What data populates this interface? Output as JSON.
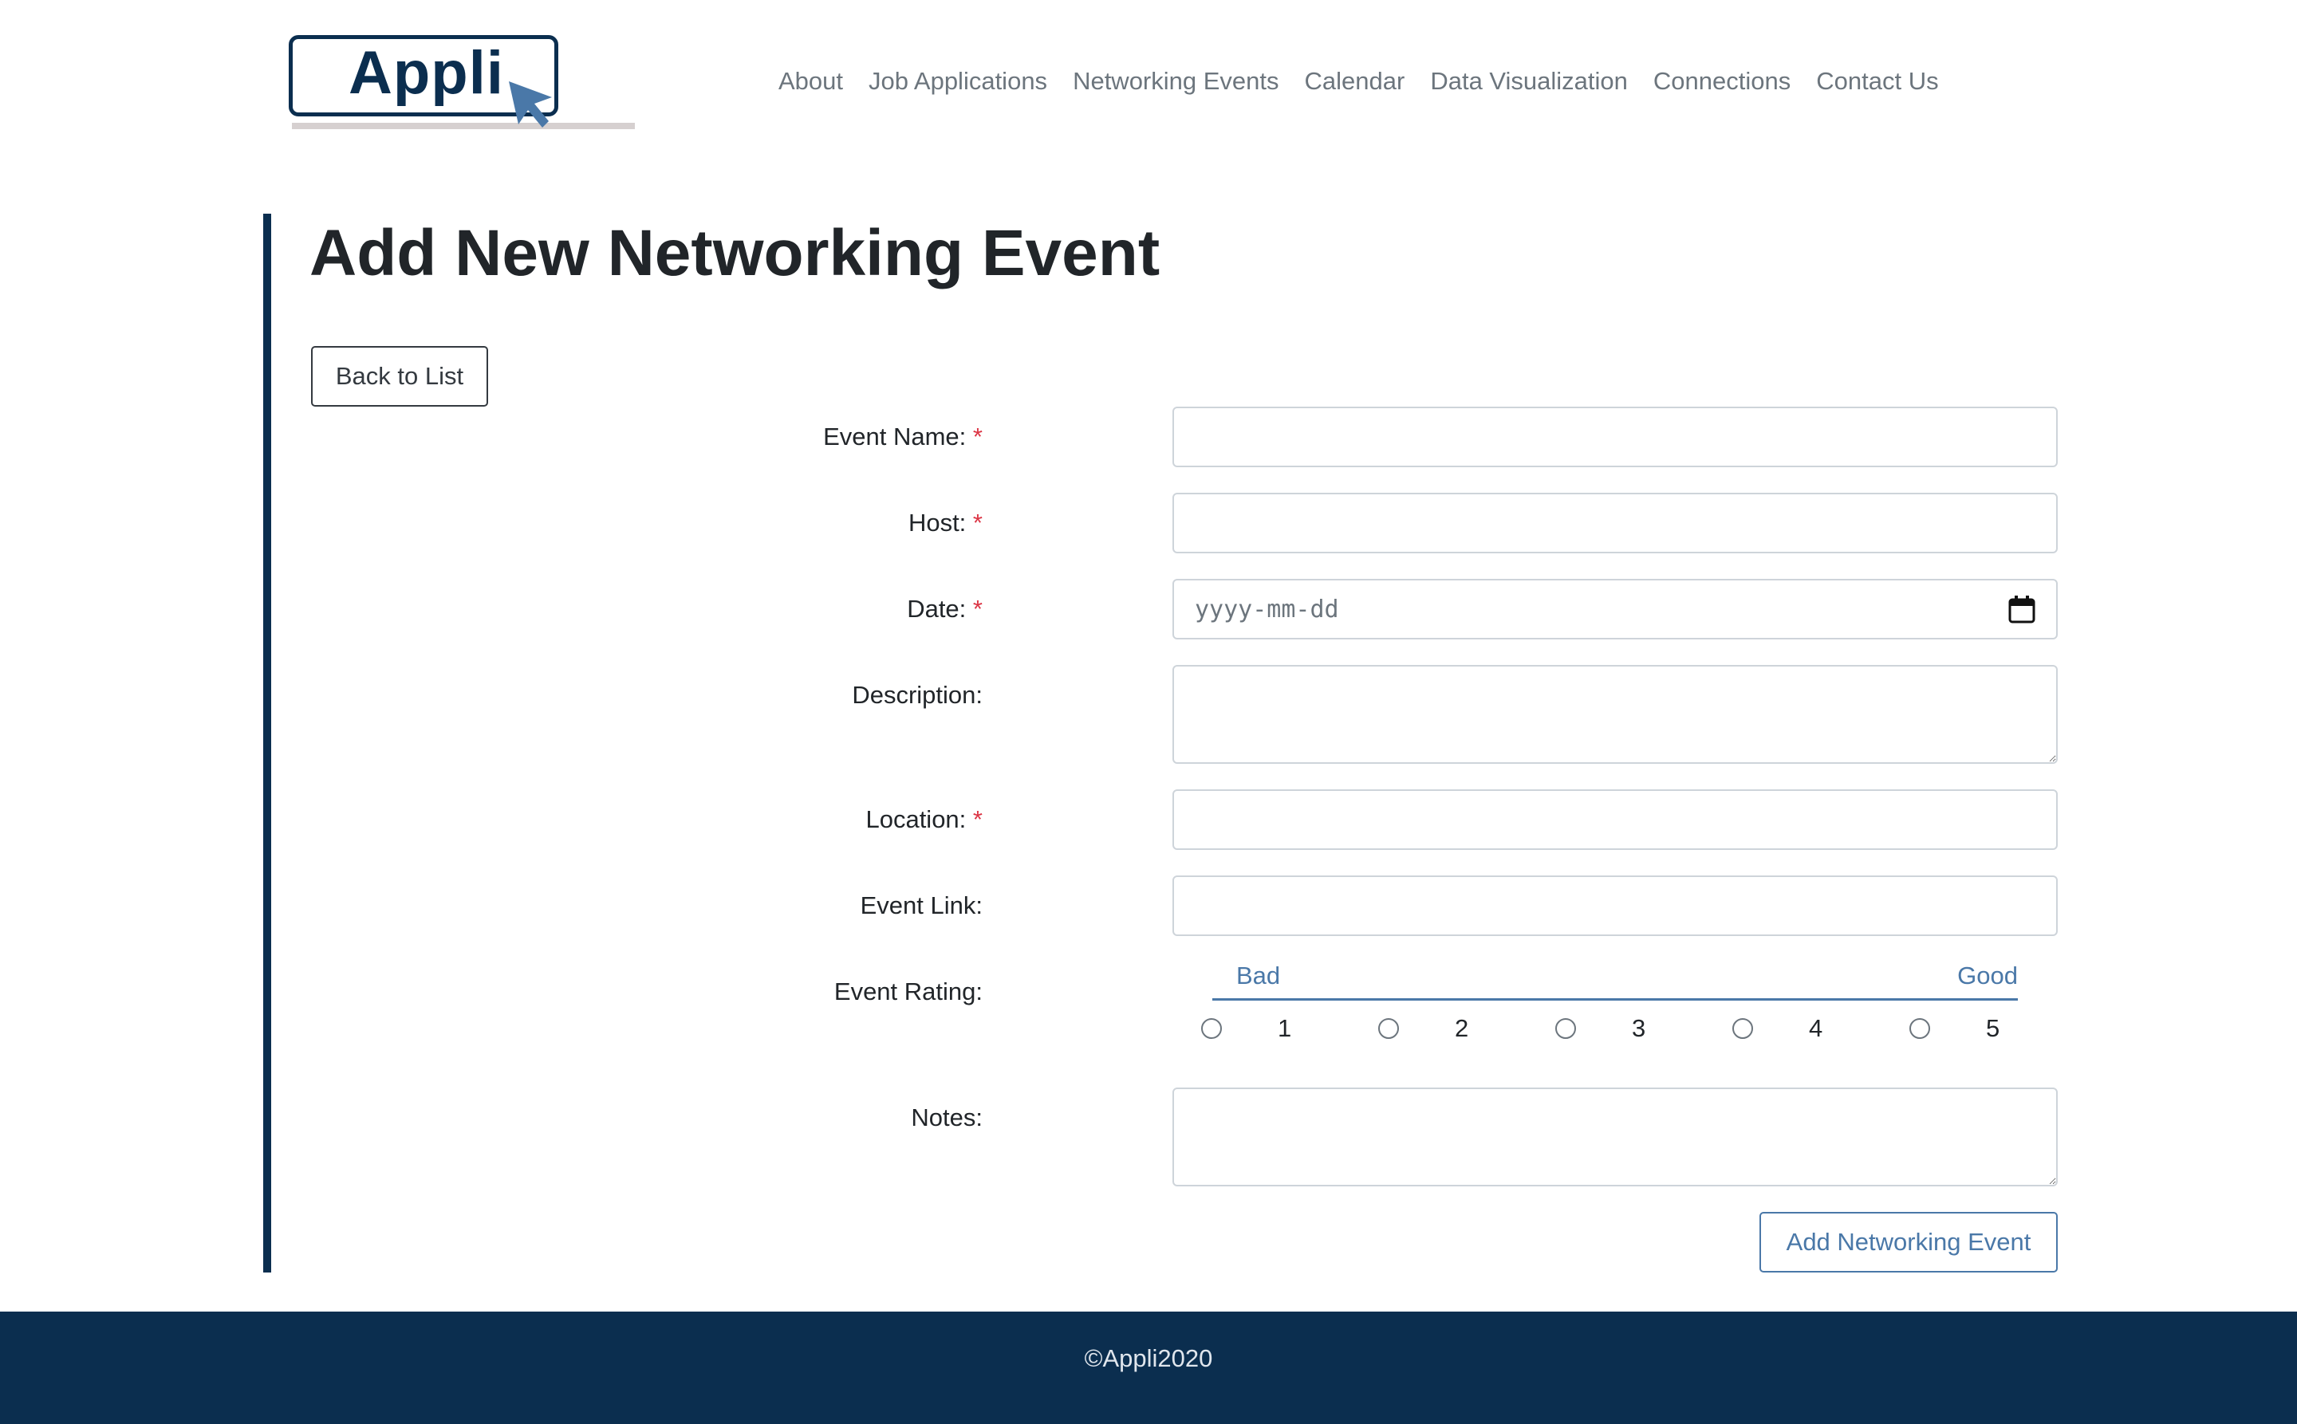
{
  "logo": {
    "text": "Appli"
  },
  "nav": {
    "items": [
      "About",
      "Job Applications",
      "Networking Events",
      "Calendar",
      "Data Visualization",
      "Connections",
      "Contact Us"
    ]
  },
  "page": {
    "title": "Add New Networking Event",
    "back_label": "Back to List"
  },
  "form": {
    "required_marker": "*",
    "event_name": {
      "label": "Event Name:",
      "value": ""
    },
    "host": {
      "label": "Host:",
      "value": ""
    },
    "date": {
      "label": "Date:",
      "placeholder": "yyyy-mm-dd"
    },
    "description": {
      "label": "Description:",
      "value": ""
    },
    "location": {
      "label": "Location:",
      "value": ""
    },
    "event_link": {
      "label": "Event Link:",
      "value": ""
    },
    "rating": {
      "label": "Event Rating:",
      "low_label": "Bad",
      "high_label": "Good",
      "options": [
        "1",
        "2",
        "3",
        "4",
        "5"
      ]
    },
    "notes": {
      "label": "Notes:",
      "value": ""
    },
    "submit_label": "Add Networking Event"
  },
  "footer": {
    "text": "©Appli2020"
  },
  "colors": {
    "brand_navy": "#0b2e4f",
    "accent_blue": "#4a78a8",
    "required_red": "#dc3545",
    "nav_gray": "#6c757d"
  },
  "icons": {
    "logo_cursor": "cursor-arrow-icon",
    "date_picker": "calendar-icon"
  }
}
